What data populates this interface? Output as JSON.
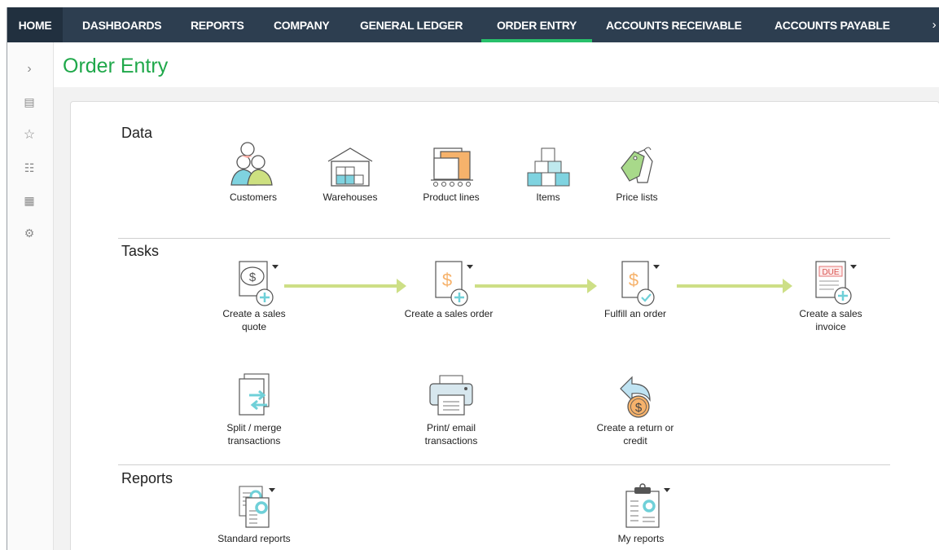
{
  "nav": {
    "home": "HOME",
    "items": [
      "DASHBOARDS",
      "REPORTS",
      "COMPANY",
      "GENERAL LEDGER",
      "ORDER ENTRY",
      "ACCOUNTS RECEIVABLE",
      "ACCOUNTS PAYABLE"
    ],
    "active": "ORDER ENTRY",
    "more": "›"
  },
  "rail": {
    "icons": [
      "chevron-right-icon",
      "list-icon",
      "star-icon",
      "report-icon",
      "document-icon",
      "gear-icon"
    ],
    "glyphs": [
      "›",
      "▤",
      "☆",
      "☷",
      "▦",
      "⚙"
    ]
  },
  "page": {
    "title": "Order Entry"
  },
  "sections": {
    "data": {
      "title": "Data",
      "tiles": [
        "Customers",
        "Warehouses",
        "Product lines",
        "Items",
        "Price lists"
      ]
    },
    "tasks": {
      "title": "Tasks",
      "tiles": [
        "Create a sales quote",
        "Create a sales order",
        "Fulfill an order",
        "Create a sales invoice",
        "Split / merge transactions",
        "Print/ email transactions",
        "Create a return or credit"
      ],
      "invoice_badge": "DUE"
    },
    "reports": {
      "title": "Reports",
      "tiles": [
        "Standard reports",
        "My reports"
      ]
    }
  },
  "colors": {
    "nav_bg": "#2d3e50",
    "accent": "#28c06b",
    "title": "#1fa84a",
    "arrow": "#cddf86",
    "teal": "#6fd0d8",
    "orange": "#f6b26b"
  }
}
